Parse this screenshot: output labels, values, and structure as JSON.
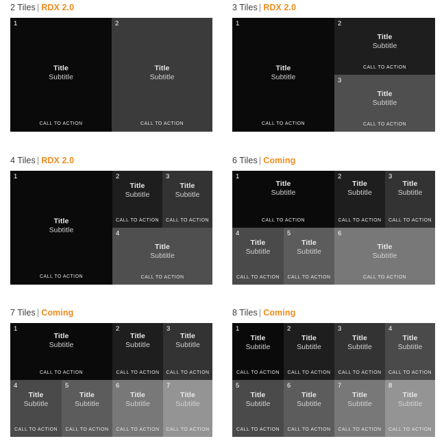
{
  "page": {
    "background": "#ffffff",
    "accent_color": "#f08c1e",
    "text_color": "#3c3c3c"
  },
  "tile_labels": {
    "title": "Title",
    "subtitle": "Subtitle",
    "cta": "CALL TO ACTION"
  },
  "shades": {
    "s1": "#0a0a0a",
    "s2": "#1e1e1e",
    "s3": "#333333",
    "s4": "#4a4a4a",
    "s5": "#5c5c5c",
    "s6": "#787878",
    "s7": "#949494"
  },
  "sections": [
    {
      "id": "two-tiles",
      "count_label": "2 Tiles",
      "separator": "|",
      "status_label": "RDX 2.0",
      "tiles": [
        {
          "num": "1",
          "title": "Title",
          "subtitle": "Subtitle",
          "cta": "CALL TO ACTION",
          "shade": "#0a0a0a"
        },
        {
          "num": "2",
          "title": "Title",
          "subtitle": "Subtitle",
          "cta": "CALL TO ACTION",
          "shade": "#3b3b3b"
        }
      ]
    },
    {
      "id": "three-tiles",
      "count_label": "3 Tiles",
      "separator": "|",
      "status_label": "RDX 2.0",
      "tiles": [
        {
          "num": "1",
          "title": "Title",
          "subtitle": "Subtitle",
          "cta": "CALL TO ACTION",
          "shade": "#0a0a0a"
        },
        {
          "num": "2",
          "title": "Title",
          "subtitle": "Subtitle",
          "cta": "CALL TO ACTION",
          "shade": "#1e1e1e"
        },
        {
          "num": "3",
          "title": "Title",
          "subtitle": "Subtitle",
          "cta": "CALL TO ACTION",
          "shade": "#4f4f4f"
        }
      ]
    },
    {
      "id": "four-tiles",
      "count_label": "4 Tiles",
      "separator": "|",
      "status_label": "RDX 2.0",
      "tiles": [
        {
          "num": "1",
          "title": "Title",
          "subtitle": "Subtitle",
          "cta": "CALL TO ACTION",
          "shade": "#0a0a0a"
        },
        {
          "num": "2",
          "title": "Title",
          "subtitle": "Subtitle",
          "cta": "CALL TO ACTION",
          "shade": "#1e1e1e"
        },
        {
          "num": "3",
          "title": "Title",
          "subtitle": "Subtitle",
          "cta": "CALL TO ACTION",
          "shade": "#333333"
        },
        {
          "num": "4",
          "title": "Title",
          "subtitle": "Subtitle",
          "cta": "CALL TO ACTION",
          "shade": "#4f4f4f"
        }
      ]
    },
    {
      "id": "six-tiles",
      "count_label": "6 Tiles",
      "separator": "|",
      "status_label": "Coming",
      "tiles": [
        {
          "num": "1",
          "title": "Title",
          "subtitle": "Subtitle",
          "cta": "CALL TO ACTION",
          "shade": "#0a0a0a"
        },
        {
          "num": "2",
          "title": "Title",
          "subtitle": "Subtitle",
          "cta": "CALL TO ACTION",
          "shade": "#1e1e1e"
        },
        {
          "num": "3",
          "title": "Title",
          "subtitle": "Subtitle",
          "cta": "CALL TO ACTION",
          "shade": "#333333"
        },
        {
          "num": "4",
          "title": "Title",
          "subtitle": "Subtitle",
          "cta": "CALL TO ACTION",
          "shade": "#4a4a4a"
        },
        {
          "num": "5",
          "title": "Title",
          "subtitle": "Subtitle",
          "cta": "CALL TO ACTION",
          "shade": "#5c5c5c"
        },
        {
          "num": "6",
          "title": "Title",
          "subtitle": "Subtitle",
          "cta": "CALL TO ACTION",
          "shade": "#787878"
        }
      ]
    },
    {
      "id": "seven-tiles",
      "count_label": "7 Tiles",
      "separator": "|",
      "status_label": "Coming",
      "tiles": [
        {
          "num": "1",
          "title": "Title",
          "subtitle": "Subtitle",
          "cta": "CALL TO ACTION",
          "shade": "#0a0a0a"
        },
        {
          "num": "2",
          "title": "Title",
          "subtitle": "Subtitle",
          "cta": "CALL TO ACTION",
          "shade": "#1e1e1e"
        },
        {
          "num": "3",
          "title": "Title",
          "subtitle": "Subtitle",
          "cta": "CALL TO ACTION",
          "shade": "#333333"
        },
        {
          "num": "4",
          "title": "Title",
          "subtitle": "Subtitle",
          "cta": "CALL TO ACTION",
          "shade": "#4a4a4a"
        },
        {
          "num": "5",
          "title": "Title",
          "subtitle": "Subtitle",
          "cta": "CALL TO ACTION",
          "shade": "#5c5c5c"
        },
        {
          "num": "6",
          "title": "Title",
          "subtitle": "Subtitle",
          "cta": "CALL TO ACTION",
          "shade": "#787878"
        },
        {
          "num": "7",
          "title": "Title",
          "subtitle": "Subtitle",
          "cta": "CALL TO ACTION",
          "shade": "#949494"
        }
      ]
    },
    {
      "id": "eight-tiles",
      "count_label": "8 Tiles",
      "separator": "|",
      "status_label": "Coming",
      "tiles": [
        {
          "num": "1",
          "title": "Title",
          "subtitle": "Subtitle",
          "cta": "CALL TO ACTION",
          "shade": "#0a0a0a"
        },
        {
          "num": "2",
          "title": "Title",
          "subtitle": "Subtitle",
          "cta": "CALL TO ACTION",
          "shade": "#1e1e1e"
        },
        {
          "num": "3",
          "title": "Title",
          "subtitle": "Subtitle",
          "cta": "CALL TO ACTION",
          "shade": "#333333"
        },
        {
          "num": "4",
          "title": "Title",
          "subtitle": "Subtitle",
          "cta": "CALL TO ACTION",
          "shade": "#4a4a4a"
        },
        {
          "num": "5",
          "title": "Title",
          "subtitle": "Subtitle",
          "cta": "CALL TO ACTION",
          "shade": "#4a4a4a"
        },
        {
          "num": "6",
          "title": "Title",
          "subtitle": "Subtitle",
          "cta": "CALL TO ACTION",
          "shade": "#5c5c5c"
        },
        {
          "num": "7",
          "title": "Title",
          "subtitle": "Subtitle",
          "cta": "CALL TO ACTION",
          "shade": "#787878"
        },
        {
          "num": "8",
          "title": "Title",
          "subtitle": "Subtitle",
          "cta": "CALL TO ACTION",
          "shade": "#949494"
        }
      ]
    }
  ]
}
